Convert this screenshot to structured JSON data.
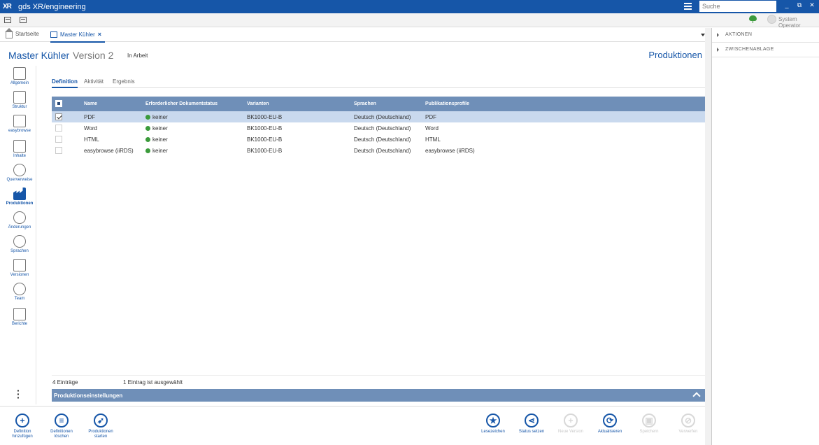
{
  "app": {
    "title": "gds XR/engineering",
    "logo": "XR",
    "search_placeholder": "Suche",
    "user": "System Operator",
    "win_min": "_",
    "win_restore": "⧉",
    "win_close": "✕"
  },
  "tabs": [
    {
      "label": "Startseite",
      "icon": "home-icon"
    },
    {
      "label": "Master Kühler",
      "icon": "document-icon",
      "close": "×"
    }
  ],
  "header": {
    "title": "Master Kühler",
    "version": "Version 2",
    "status": "In Arbeit",
    "section": "Produktionen"
  },
  "leftnav": [
    {
      "label": "Allgemein",
      "icon": "document-icon"
    },
    {
      "label": "Struktur",
      "icon": "structure-icon"
    },
    {
      "label": "easybrowse",
      "icon": "easybrowse-icon"
    },
    {
      "label": "Inhalte",
      "icon": "content-icon"
    },
    {
      "label": "Querverweise",
      "icon": "link-icon"
    },
    {
      "label": "Produktionen",
      "icon": "factory-icon",
      "active": true
    },
    {
      "label": "Änderungen",
      "icon": "changes-icon"
    },
    {
      "label": "Sprachen",
      "icon": "globe-icon"
    },
    {
      "label": "Versionen",
      "icon": "versions-icon"
    },
    {
      "label": "Team",
      "icon": "team-icon"
    },
    {
      "label": "Berichte",
      "icon": "reports-icon"
    }
  ],
  "subtabs": [
    "Definition",
    "Aktivität",
    "Ergebnis"
  ],
  "grid": {
    "columns": [
      "Name",
      "Erforderlicher Dokumentstatus",
      "Varianten",
      "Sprachen",
      "Publikationsprofile"
    ],
    "rows": [
      {
        "name": "PDF",
        "status": "keiner",
        "variant": "BK1000-EU-B",
        "language": "Deutsch (Deutschland)",
        "profile": "PDF",
        "selected": true
      },
      {
        "name": "Word",
        "status": "keiner",
        "variant": "BK1000-EU-B",
        "language": "Deutsch (Deutschland)",
        "profile": "Word",
        "selected": false
      },
      {
        "name": "HTML",
        "status": "keiner",
        "variant": "BK1000-EU-B",
        "language": "Deutsch (Deutschland)",
        "profile": "HTML",
        "selected": false
      },
      {
        "name": "easybrowse (iiRDS)",
        "status": "keiner",
        "variant": "BK1000-EU-B",
        "language": "Deutsch (Deutschland)",
        "profile": "easybrowse (iiRDS)",
        "selected": false
      }
    ]
  },
  "footer": {
    "count": "4 Einträge",
    "selected": "1 Eintrag ist ausgewählt"
  },
  "settings_bar": "Produktionseinstellungen",
  "actions": {
    "add": {
      "line1": "Definition",
      "line2": "hinzufügen"
    },
    "delete": {
      "line1": "Definitionen",
      "line2": "löschen"
    },
    "start": {
      "line1": "Produktionen",
      "line2": "starten"
    },
    "bookmark": "Lesezeichen",
    "status": "Status setzen",
    "new_version": "Neue Version",
    "refresh": "Aktualisieren",
    "save": "Speichern",
    "discard": "Verwerfen"
  },
  "rightpanel": [
    "AKTIONEN",
    "ZWISCHENABLAGE"
  ],
  "colors": {
    "accent": "#1656a8",
    "grid_header": "#6f8fb8",
    "selected_row": "#c9d9ee",
    "status_ok": "#3b9b3b"
  }
}
